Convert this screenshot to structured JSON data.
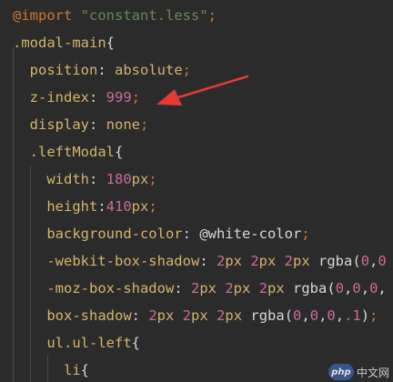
{
  "lines": [
    {
      "tokens": [
        {
          "text": "@import",
          "cls": "kw"
        },
        {
          "text": " ",
          "cls": "punc"
        },
        {
          "text": "\"constant.less\"",
          "cls": "str"
        },
        {
          "text": ";",
          "cls": "kw"
        }
      ]
    },
    {
      "tokens": [
        {
          "text": ".modal-main",
          "cls": "sel"
        },
        {
          "text": "{",
          "cls": "punc"
        }
      ]
    },
    {
      "tokens": [
        {
          "text": "  position",
          "cls": "prop"
        },
        {
          "text": ": ",
          "cls": "punc"
        },
        {
          "text": "absolute",
          "cls": "val"
        },
        {
          "text": ";",
          "cls": "kw"
        }
      ]
    },
    {
      "tokens": [
        {
          "text": "  z-index",
          "cls": "prop"
        },
        {
          "text": ": ",
          "cls": "punc"
        },
        {
          "text": "999",
          "cls": "num"
        },
        {
          "text": ";",
          "cls": "kw"
        }
      ]
    },
    {
      "tokens": [
        {
          "text": "  display",
          "cls": "prop"
        },
        {
          "text": ": ",
          "cls": "punc"
        },
        {
          "text": "none",
          "cls": "val"
        },
        {
          "text": ";",
          "cls": "kw"
        }
      ]
    },
    {
      "tokens": [
        {
          "text": "  .leftModal",
          "cls": "sel"
        },
        {
          "text": "{",
          "cls": "punc"
        }
      ]
    },
    {
      "tokens": [
        {
          "text": "    width",
          "cls": "prop"
        },
        {
          "text": ": ",
          "cls": "punc"
        },
        {
          "text": "180",
          "cls": "num"
        },
        {
          "text": "px",
          "cls": "val"
        },
        {
          "text": ";",
          "cls": "kw"
        }
      ]
    },
    {
      "tokens": [
        {
          "text": "    height",
          "cls": "prop"
        },
        {
          "text": ":",
          "cls": "punc"
        },
        {
          "text": "410",
          "cls": "num"
        },
        {
          "text": "px",
          "cls": "val"
        },
        {
          "text": ";",
          "cls": "kw"
        }
      ]
    },
    {
      "tokens": [
        {
          "text": "    background-color",
          "cls": "prop"
        },
        {
          "text": ": ",
          "cls": "punc"
        },
        {
          "text": "@white-color",
          "cls": "var"
        },
        {
          "text": ";",
          "cls": "kw"
        }
      ]
    },
    {
      "tokens": [
        {
          "text": "    -webkit-box-shadow",
          "cls": "prop"
        },
        {
          "text": ": ",
          "cls": "punc"
        },
        {
          "text": "2",
          "cls": "num"
        },
        {
          "text": "px ",
          "cls": "val"
        },
        {
          "text": "2",
          "cls": "num"
        },
        {
          "text": "px ",
          "cls": "val"
        },
        {
          "text": "2",
          "cls": "num"
        },
        {
          "text": "px ",
          "cls": "val"
        },
        {
          "text": "rgba",
          "cls": "fn"
        },
        {
          "text": "(",
          "cls": "punc"
        },
        {
          "text": "0",
          "cls": "num"
        },
        {
          "text": ",",
          "cls": "punc"
        },
        {
          "text": "0",
          "cls": "num"
        }
      ]
    },
    {
      "tokens": [
        {
          "text": "    -moz-box-shadow",
          "cls": "prop"
        },
        {
          "text": ": ",
          "cls": "punc"
        },
        {
          "text": "2",
          "cls": "num"
        },
        {
          "text": "px ",
          "cls": "val"
        },
        {
          "text": "2",
          "cls": "num"
        },
        {
          "text": "px ",
          "cls": "val"
        },
        {
          "text": "2",
          "cls": "num"
        },
        {
          "text": "px ",
          "cls": "val"
        },
        {
          "text": "rgba",
          "cls": "fn"
        },
        {
          "text": "(",
          "cls": "punc"
        },
        {
          "text": "0",
          "cls": "num"
        },
        {
          "text": ",",
          "cls": "punc"
        },
        {
          "text": "0",
          "cls": "num"
        },
        {
          "text": ",",
          "cls": "punc"
        },
        {
          "text": "0",
          "cls": "num"
        },
        {
          "text": ",",
          "cls": "punc"
        }
      ]
    },
    {
      "tokens": [
        {
          "text": "    box-shadow",
          "cls": "prop"
        },
        {
          "text": ": ",
          "cls": "punc"
        },
        {
          "text": "2",
          "cls": "num"
        },
        {
          "text": "px ",
          "cls": "val"
        },
        {
          "text": "2",
          "cls": "num"
        },
        {
          "text": "px ",
          "cls": "val"
        },
        {
          "text": "2",
          "cls": "num"
        },
        {
          "text": "px ",
          "cls": "val"
        },
        {
          "text": "rgba",
          "cls": "fn"
        },
        {
          "text": "(",
          "cls": "punc"
        },
        {
          "text": "0",
          "cls": "num"
        },
        {
          "text": ",",
          "cls": "punc"
        },
        {
          "text": "0",
          "cls": "num"
        },
        {
          "text": ",",
          "cls": "punc"
        },
        {
          "text": "0",
          "cls": "num"
        },
        {
          "text": ",",
          "cls": "punc"
        },
        {
          "text": ".1",
          "cls": "num"
        },
        {
          "text": ")",
          "cls": "punc"
        },
        {
          "text": ";",
          "cls": "kw"
        }
      ]
    },
    {
      "tokens": [
        {
          "text": "    ul.ul-left",
          "cls": "sel"
        },
        {
          "text": "{",
          "cls": "punc"
        }
      ]
    },
    {
      "tokens": [
        {
          "text": "      li",
          "cls": "sel"
        },
        {
          "text": "{",
          "cls": "punc"
        }
      ]
    }
  ],
  "watermark": {
    "logo": "php",
    "text": "中文网"
  },
  "colors": {
    "background": "#2b2b2b",
    "keyword": "#cc7832",
    "string": "#6a8759",
    "property": "#d5b56a",
    "number": "#cc6b9c",
    "arrow": "#e53935"
  }
}
